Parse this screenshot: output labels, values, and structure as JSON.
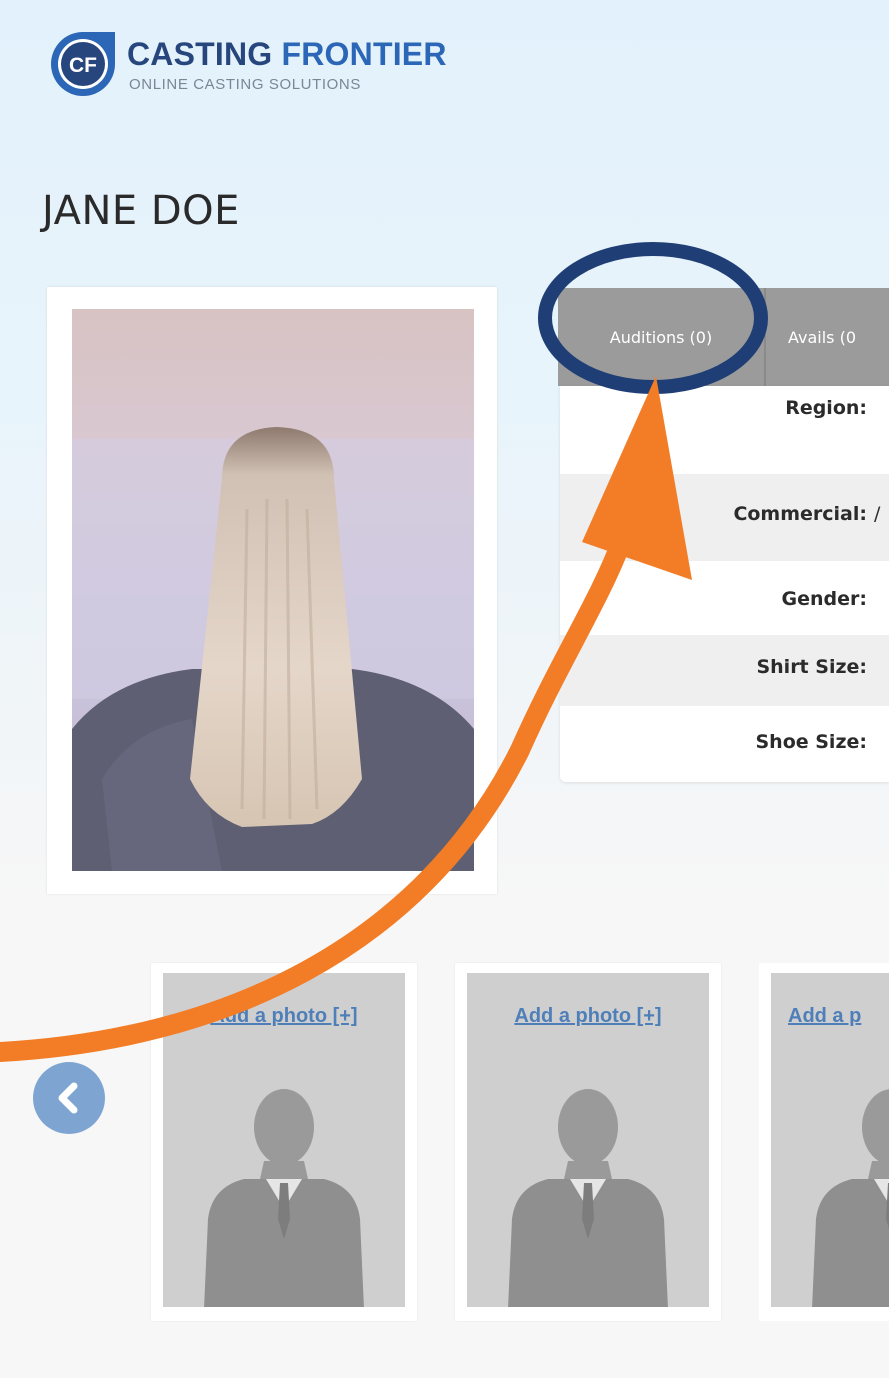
{
  "brand": {
    "logo_badge": "CF",
    "name_part1": "CASTING",
    "name_part2": "FRONTIER",
    "tagline": "ONLINE CASTING SOLUTIONS",
    "colors": {
      "dark_blue": "#27467e",
      "blue": "#2b67b6",
      "annotation_orange": "#f27d26",
      "annotation_circle": "#1f3e76"
    }
  },
  "profile": {
    "name": "JANE DOE"
  },
  "tabs": [
    {
      "label": "Auditions (0)",
      "highlighted": true
    },
    {
      "label": "Avails (0"
    }
  ],
  "details": [
    {
      "label": "Region:",
      "value": ""
    },
    {
      "label": "Commercial:",
      "value": "/"
    },
    {
      "label": "Gender:",
      "value": ""
    },
    {
      "label": "Shirt Size:",
      "value": ""
    },
    {
      "label": "Shoe Size:",
      "value": ""
    }
  ],
  "carousel": {
    "prev_icon": "chevron-left-icon",
    "thumbnails": [
      {
        "link": "Add a photo [+]",
        "icon": "person-silhouette-icon"
      },
      {
        "link": "Add a photo [+]",
        "icon": "person-silhouette-icon"
      },
      {
        "link": "Add a p",
        "icon": "person-silhouette-icon"
      }
    ]
  }
}
